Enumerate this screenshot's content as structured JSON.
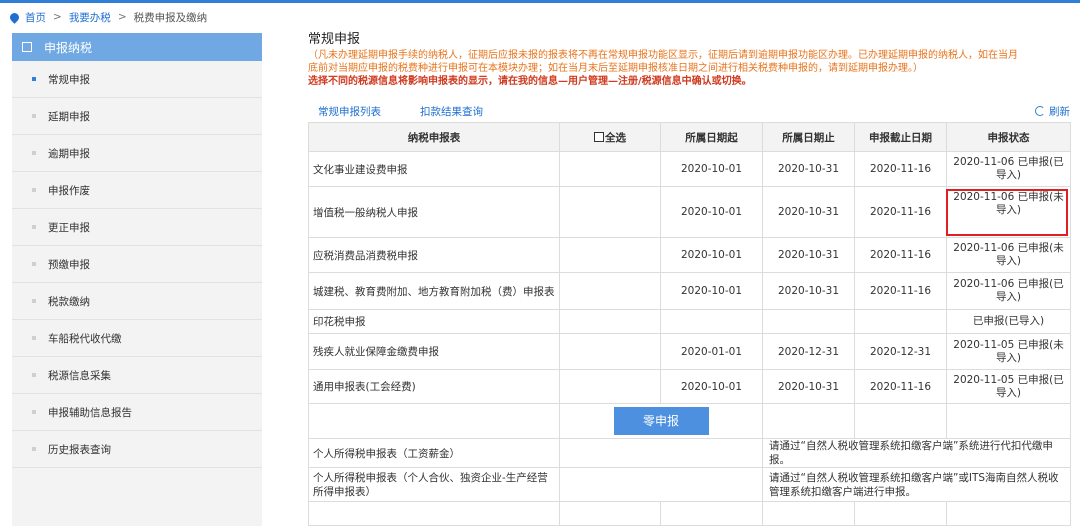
{
  "breadcrumb": {
    "home": "首页",
    "sep": ">",
    "level2": "我要办税",
    "current": "税费申报及缴纳"
  },
  "sidebar": {
    "header": "申报纳税",
    "items": [
      {
        "label": "常规申报",
        "active": true
      },
      {
        "label": "延期申报"
      },
      {
        "label": "逾期申报"
      },
      {
        "label": "申报作废"
      },
      {
        "label": "更正申报"
      },
      {
        "label": "预缴申报"
      },
      {
        "label": "税款缴纳"
      },
      {
        "label": "车船税代收代缴"
      },
      {
        "label": "税源信息采集"
      },
      {
        "label": "申报辅助信息报告"
      },
      {
        "label": "历史报表查询"
      }
    ]
  },
  "main": {
    "title": "常规申报",
    "notice_line1": "（凡未办理延期申报手续的纳税人，征期后应报未报的报表将不再在常规申报功能区显示，征期后请到逾期申报功能区办理。已办理延期申报的纳税人，如在当月",
    "notice_line2": "底前对当期应申报的税费种进行申报可在本模块办理；如在当月末后至延期申报核准日期之间进行相关税费种申报的，请到延期申报办理。）",
    "notice_line3": "选择不同的税源信息将影响申报表的显示，请在我的信息—用户管理—注册/税源信息中确认或切换。",
    "tab1": "常规申报列表",
    "tab2": "扣款结果查询",
    "refresh": "刷新"
  },
  "table": {
    "headers": {
      "name": "纳税申报表",
      "select_all": "全选",
      "start": "所属日期起",
      "end": "所属日期止",
      "deadline": "申报截止日期",
      "status": "申报状态"
    },
    "rows": [
      {
        "name": "文化事业建设费申报",
        "start": "2020-10-01",
        "end": "2020-10-31",
        "deadline": "2020-11-16",
        "status": "2020-11-06 已申报(已导入)"
      },
      {
        "name": "增值税一般纳税人申报",
        "start": "2020-10-01",
        "end": "2020-10-31",
        "deadline": "2020-11-16",
        "status": "2020-11-06 已申报(未导入)"
      },
      {
        "name": "应税消费品消费税申报",
        "start": "2020-10-01",
        "end": "2020-10-31",
        "deadline": "2020-11-16",
        "status": "2020-11-06 已申报(未导入)"
      },
      {
        "name": "城建税、教育费附加、地方教育附加税（费）申报表",
        "start": "2020-10-01",
        "end": "2020-10-31",
        "deadline": "2020-11-16",
        "status": "2020-11-06 已申报(已导入)"
      },
      {
        "name": "印花税申报",
        "start": "",
        "end": "",
        "deadline": "",
        "status": "已申报(已导入)"
      },
      {
        "name": "残疾人就业保障金缴费申报",
        "start": "2020-01-01",
        "end": "2020-12-31",
        "deadline": "2020-12-31",
        "status": "2020-11-05 已申报(未导入)"
      },
      {
        "name": "通用申报表(工会经费)",
        "start": "2020-10-01",
        "end": "2020-10-31",
        "deadline": "2020-11-16",
        "status": "2020-11-05 已申报(已导入)"
      }
    ],
    "zero_button": "零申报",
    "personal_rows": [
      {
        "name": "个人所得税申报表（工资薪金）",
        "note": "请通过“自然人税收管理系统扣缴客户端”系统进行代扣代缴申报。"
      },
      {
        "name": "个人所得税申报表（个人合伙、独资企业-生产经营所得申报表）",
        "note": "请通过“自然人税收管理系统扣缴客户端”或ITS海南自然人税收管理系统扣缴客户端进行申报。"
      }
    ]
  },
  "colors": {
    "accent": "#2f7ed8",
    "notice": "#e8741c",
    "highlight": "#e02020"
  }
}
